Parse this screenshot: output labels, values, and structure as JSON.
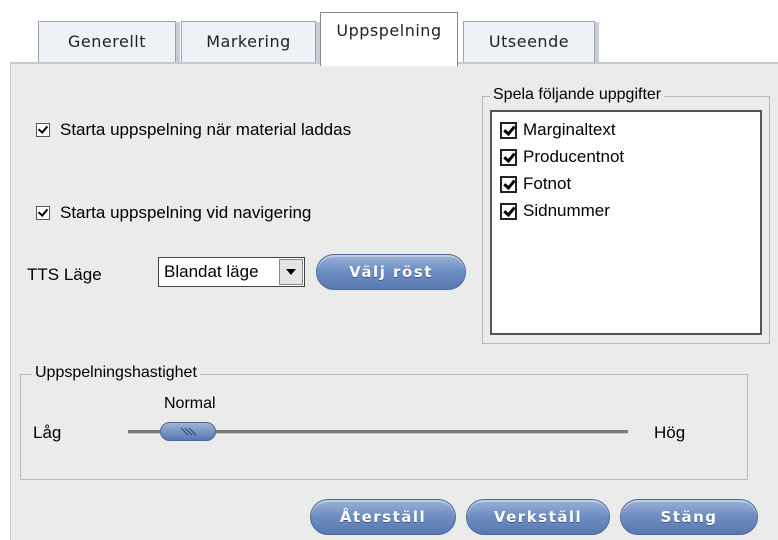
{
  "tabs": [
    {
      "label": "Generellt",
      "active": false
    },
    {
      "label": "Markering",
      "active": false
    },
    {
      "label": "Uppspelning",
      "active": true
    },
    {
      "label": "Utseende",
      "active": false
    }
  ],
  "playback": {
    "start_on_load": {
      "label": "Starta uppspelning när material laddas",
      "checked": true
    },
    "start_on_navigation": {
      "label": "Starta uppspelning vid navigering",
      "checked": true
    }
  },
  "tts": {
    "label": "TTS Läge",
    "selected": "Blandat läge",
    "voice_button": "Välj röst"
  },
  "read_items": {
    "title": "Spela följande uppgifter",
    "items": [
      {
        "label": "Marginaltext",
        "checked": true
      },
      {
        "label": "Producentnot",
        "checked": true
      },
      {
        "label": "Fotnot",
        "checked": true
      },
      {
        "label": "Sidnummer",
        "checked": true
      }
    ]
  },
  "speed": {
    "title": "Uppspelningshastighet",
    "low_label": "Låg",
    "high_label": "Hög",
    "current_label": "Normal",
    "value_fraction": 0.12
  },
  "footer": {
    "reset": "Återställ",
    "apply": "Verkställ",
    "close": "Stäng"
  },
  "colors": {
    "button": "#6f8fc4",
    "panel": "#ebebeb"
  }
}
